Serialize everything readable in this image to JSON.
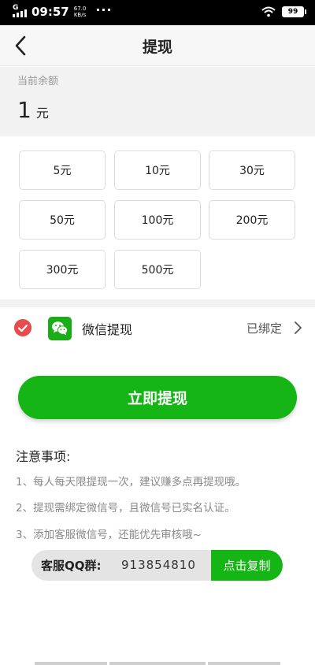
{
  "status_bar": {
    "network": "G",
    "time": "09:57",
    "speed_value": "67.0",
    "speed_unit": "KB/s",
    "more": "···",
    "battery": "99"
  },
  "header": {
    "title": "提现"
  },
  "balance": {
    "label": "当前余额",
    "value": "1",
    "unit": "元"
  },
  "amounts": [
    "5元",
    "10元",
    "30元",
    "50元",
    "100元",
    "200元",
    "300元",
    "500元"
  ],
  "payment": {
    "method_label": "微信提现",
    "status": "已绑定",
    "selected": true
  },
  "withdraw_button": "立即提现",
  "notes": {
    "title": "注意事项:",
    "items": [
      "1、每人每天限提现一次，建议赚多点再提现哦。",
      "2、提现需绑定微信号，且微信号已实名认证。",
      "3、添加客服微信号，还能优先审核哦~"
    ]
  },
  "qq_group": {
    "label": "客服QQ群:",
    "number": "913854810",
    "copy_button": "点击复制"
  },
  "colors": {
    "accent_green": "#14b514",
    "check_red": "#e84b4b",
    "wechat_green": "#1aad19"
  },
  "icons": [
    "back-arrow-icon",
    "check-icon",
    "wechat-icon",
    "chevron-right-icon",
    "wifi-icon",
    "signal-icon",
    "battery-icon"
  ]
}
